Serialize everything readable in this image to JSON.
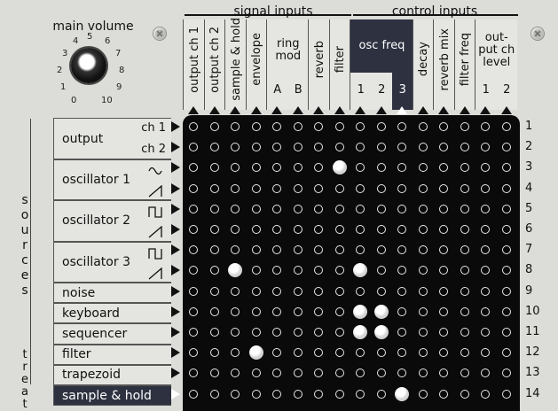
{
  "main_volume": {
    "title": "main volume",
    "dial_numbers": [
      "0",
      "1",
      "2",
      "3",
      "4",
      "5",
      "6",
      "7",
      "8",
      "9",
      "10"
    ],
    "level": 9
  },
  "groups": {
    "signal_inputs": "signal inputs",
    "control_inputs": "control inputs"
  },
  "columns": [
    {
      "label": "output ch 1",
      "vertical": true
    },
    {
      "label": "output ch 2",
      "vertical": true
    },
    {
      "label": "sample & hold",
      "vertical": true
    },
    {
      "label": "envelope",
      "vertical": true
    },
    {
      "label": "ring mod",
      "sub": [
        "A",
        "B"
      ]
    },
    {
      "label": "reverb",
      "vertical": true
    },
    {
      "label": "filter",
      "vertical": true
    },
    {
      "label": "osc freq",
      "sub": [
        "1",
        "2",
        "3"
      ],
      "selected_sub": "3"
    },
    {
      "label": "decay",
      "vertical": true
    },
    {
      "label": "reverb mix",
      "vertical": true
    },
    {
      "label": "filter freq",
      "vertical": true
    },
    {
      "label": "out-put ch level",
      "sub": [
        "1",
        "2"
      ]
    }
  ],
  "sources": {
    "side_label": "sources",
    "side_letters": [
      "s",
      "o",
      "u",
      "r",
      "c",
      "e",
      "s"
    ],
    "treat_label": "treat",
    "treat_letters": [
      "t",
      "r",
      "e",
      "a",
      "t"
    ],
    "items": [
      {
        "label": "output",
        "subs": [
          "ch 1",
          "ch 2"
        ]
      },
      {
        "label": "oscillator 1",
        "subs": [
          "sine",
          "sawtooth"
        ]
      },
      {
        "label": "oscillator 2",
        "subs": [
          "square",
          "sawtooth"
        ]
      },
      {
        "label": "oscillator 3",
        "subs": [
          "square",
          "sawtooth"
        ]
      },
      {
        "label": "noise"
      },
      {
        "label": "keyboard"
      },
      {
        "label": "sequencer"
      },
      {
        "label": "filter"
      },
      {
        "label": "trapezoid"
      },
      {
        "label": "sample & hold",
        "selected": true
      }
    ]
  },
  "row_numbers": [
    "1",
    "2",
    "3",
    "4",
    "5",
    "6",
    "7",
    "8",
    "9",
    "10",
    "11",
    "12",
    "13",
    "14"
  ],
  "pins": [
    {
      "row": 3,
      "col": 8
    },
    {
      "row": 8,
      "col": 3
    },
    {
      "row": 8,
      "col": 9
    },
    {
      "row": 10,
      "col": 9
    },
    {
      "row": 10,
      "col": 10
    },
    {
      "row": 11,
      "col": 9
    },
    {
      "row": 11,
      "col": 10
    },
    {
      "row": 12,
      "col": 4
    },
    {
      "row": 14,
      "col": 11
    }
  ],
  "colors": {
    "panel": "#dcdcd8",
    "grid": "#0a0a0a",
    "selected": "#2e3140"
  }
}
